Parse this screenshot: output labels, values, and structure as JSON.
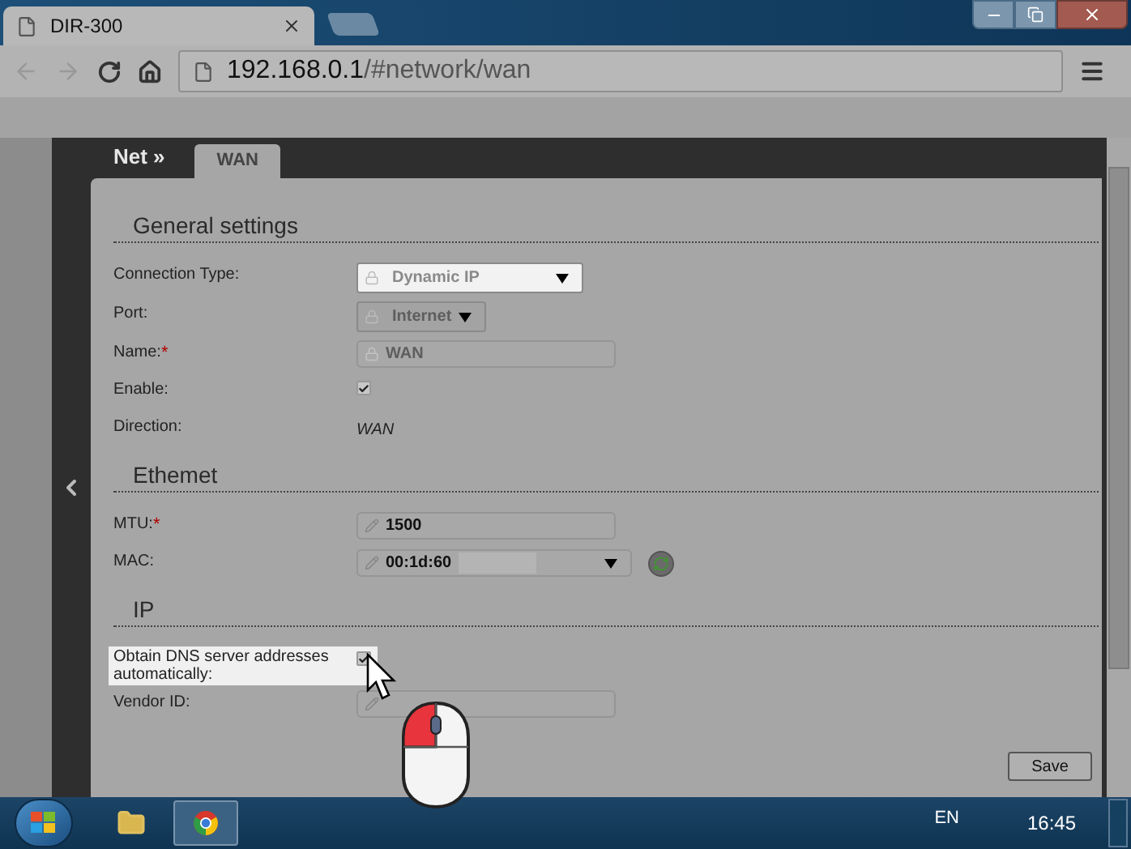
{
  "browser": {
    "tab_title": "DIR-300",
    "url_host": "192.168.0.1",
    "url_path": "/#network/wan"
  },
  "page": {
    "breadcrumb": "Net »",
    "tabs": [
      {
        "label": "WAN",
        "selected": true
      }
    ],
    "sections": [
      {
        "title": "General settings",
        "fields": [
          {
            "kind": "select",
            "label": "Connection Type:",
            "value": "Dynamic IP",
            "disabled": false
          },
          {
            "kind": "select",
            "label": "Port:",
            "value": "Internet",
            "disabled": true
          },
          {
            "kind": "input",
            "label": "Name:",
            "required_mark": "*",
            "value": "WAN",
            "locked": true
          },
          {
            "kind": "checkbox",
            "label": "Enable:",
            "checked": true,
            "highlighted": false
          },
          {
            "kind": "text",
            "label": "Direction:",
            "value": "WAN"
          }
        ]
      },
      {
        "title": "Ethemet",
        "fields": [
          {
            "kind": "input",
            "label": "MTU:",
            "required_mark": "*",
            "value": "1500",
            "locked": false
          },
          {
            "kind": "mac",
            "label": "MAC:",
            "value": "00:1d:60"
          }
        ]
      },
      {
        "title": "IP",
        "fields": [
          {
            "kind": "checkbox",
            "label": "Obtain DNS server addresses automatically:",
            "checked": true,
            "highlighted": true
          },
          {
            "kind": "input",
            "label": "Vendor ID:",
            "locked": false
          }
        ]
      }
    ],
    "save_button": "Save"
  },
  "taskbar": {
    "language": "EN",
    "clock": "16:45"
  }
}
